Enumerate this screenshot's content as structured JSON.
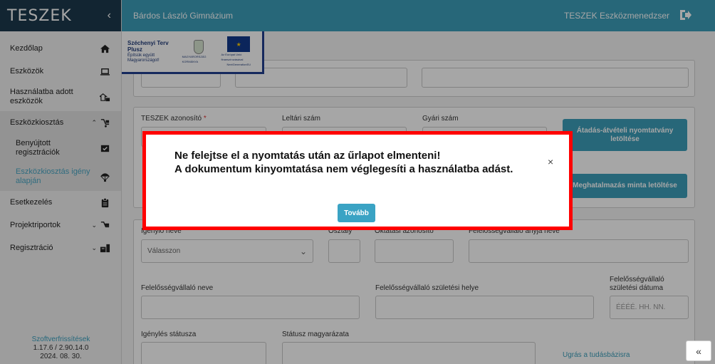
{
  "app": {
    "brand": "TESZEK",
    "school": "Bárdos László Gimnázium",
    "system": "TESZEK Eszközmenedzser"
  },
  "sidebar": {
    "items": [
      {
        "label": "Kezdőlap",
        "icon": "home-icon"
      },
      {
        "label": "Eszközök",
        "icon": "laptop-icon"
      },
      {
        "label": "Használatba adott eszközök",
        "icon": "assign-icon"
      },
      {
        "label": "Eszközkiosztás",
        "icon": "distribution-icon"
      },
      {
        "label": "Benyújtott regisztrációk",
        "icon": "inbox-icon"
      },
      {
        "label": "Eszközkiosztás igény alapján",
        "icon": "parachute-icon"
      },
      {
        "label": "Esetkezelés",
        "icon": "clipboard-icon"
      },
      {
        "label": "Projektriportok",
        "icon": "report-icon"
      },
      {
        "label": "Regisztráció",
        "icon": "registration-icon"
      }
    ],
    "footer": {
      "link": "Szoftverfrissítések",
      "version": "1.17.6 / 2.90.14.0",
      "date": "2024. 08. 30."
    }
  },
  "banner": {
    "plan_title": "Széchenyi Terv",
    "plan_sub": "Plusz",
    "plan_tag": "Építsük együtt Magyarországot!",
    "gov": "MAGYARORSZÁG KORMÁNYA",
    "eu": "Az Európai Unió finanszírozásával",
    "eu2": "NextGenerationEU"
  },
  "form": {
    "teszek_id_label": "TESZEK azonosító",
    "required_mark": "*",
    "inventory_label": "Leltári szám",
    "serial_label": "Gyári szám",
    "handover_btn": "Átadás-átvételi nyomtatvány letöltése",
    "authorization_btn": "Meghatalmazás minta letöltése",
    "requester_label": "Igénylő neve",
    "requester_placeholder": "Válasszon",
    "class_label": "Osztály",
    "edu_id_label": "Oktatási azonosító",
    "mother_label": "Felelősségvállaló anyja neve",
    "resp_name_label": "Felelősségvállaló neve",
    "resp_birthplace_label": "Felelősségvállaló születési helye",
    "resp_birthdate_label": "Felelősségvállaló születési dátuma",
    "date_placeholder": "ÉÉÉÉ. HH. NN.",
    "status_label": "Igénylés státusza",
    "status_reason_label": "Státusz magyarázata",
    "kb_link": "Ugrás a tudásbázisra"
  },
  "modal": {
    "line1": "Ne felejtse el a nyomtatás után az űrlapot elmenteni!",
    "line2": "A dokumentum kinyomtatása nem véglegesíti a használatba adást.",
    "close": "×",
    "continue": "Tovább"
  },
  "scroll_top": "«"
}
